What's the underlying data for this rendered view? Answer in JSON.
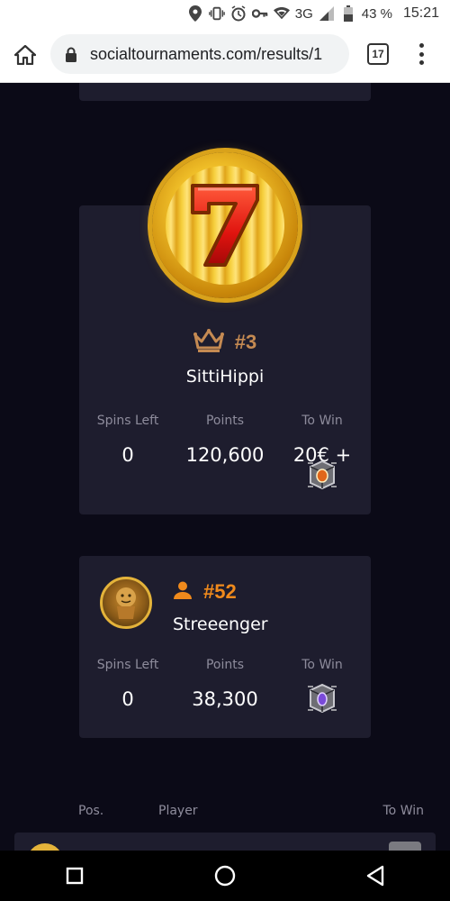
{
  "status_bar": {
    "network": "3G",
    "battery": "43 %",
    "time": "15:21",
    "icons": [
      "location-icon",
      "vibrate-icon",
      "alarm-icon",
      "vpn-key-icon",
      "wifi-icon",
      "signal-icon",
      "battery-icon"
    ]
  },
  "browser": {
    "url": "socialtournaments.com/results/1",
    "tab_count": "17"
  },
  "top_player": {
    "rank": "#3",
    "name": "SittiHippi",
    "stats": {
      "spins_left_label": "Spins Left",
      "spins_left": "0",
      "points_label": "Points",
      "points": "120,600",
      "to_win_label": "To Win",
      "to_win": "20€ +"
    }
  },
  "current_player": {
    "rank": "#52",
    "name": "Streeenger",
    "stats": {
      "spins_left_label": "Spins Left",
      "spins_left": "0",
      "points_label": "Points",
      "points": "38,300",
      "to_win_label": "To Win"
    }
  },
  "table": {
    "headers": {
      "pos": "Pos.",
      "player": "Player",
      "to_win": "To Win"
    }
  },
  "colors": {
    "background": "#0b0a17",
    "card": "#1e1d2e",
    "rank_bronze": "#c58a52",
    "rank_orange": "#f08a1c",
    "muted_text": "#8e8c9c"
  }
}
